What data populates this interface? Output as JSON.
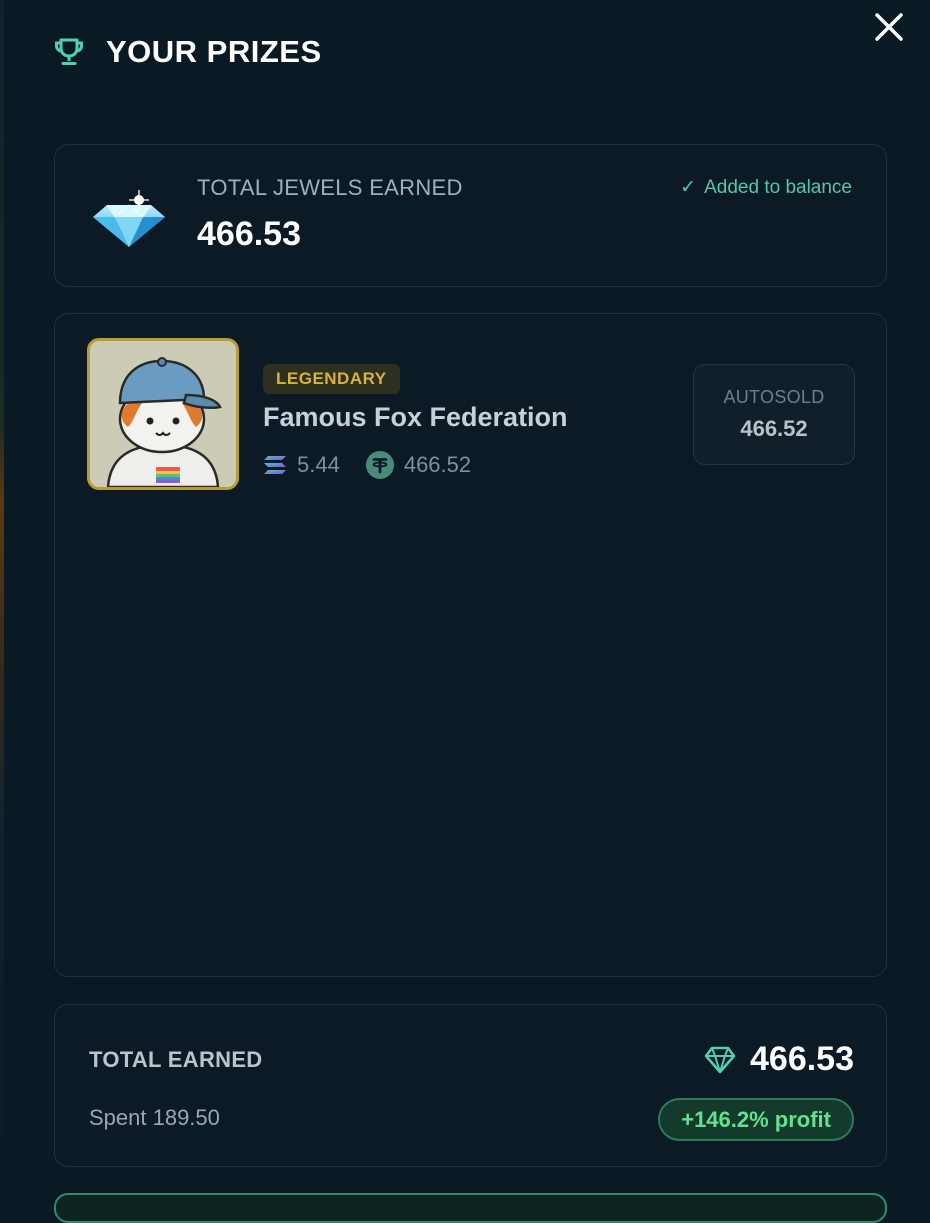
{
  "header": {
    "title": "YOUR PRIZES",
    "icon": "trophy-icon",
    "close_icon": "close-icon"
  },
  "jewels": {
    "label": "TOTAL JEWELS EARNED",
    "value": "466.53",
    "status_check": "✓",
    "status": "Added to balance",
    "icon": "diamond-icon"
  },
  "prize": {
    "rarity": "LEGENDARY",
    "name": "Famous Fox Federation",
    "sol_price": "5.44",
    "usdt_price": "466.52",
    "autosold_label": "AUTOSOLD",
    "autosold_value": "466.52",
    "icons": [
      "solana-icon",
      "tether-icon"
    ]
  },
  "summary": {
    "total_label": "TOTAL EARNED",
    "total_value": "466.53",
    "spent": "Spent 189.50",
    "profit": "+146.2% profit"
  },
  "colors": {
    "background": "#0a1a24",
    "accent_teal": "#56c6a5",
    "legendary_gold": "#d6b33c",
    "profit_green": "#62e28f"
  }
}
